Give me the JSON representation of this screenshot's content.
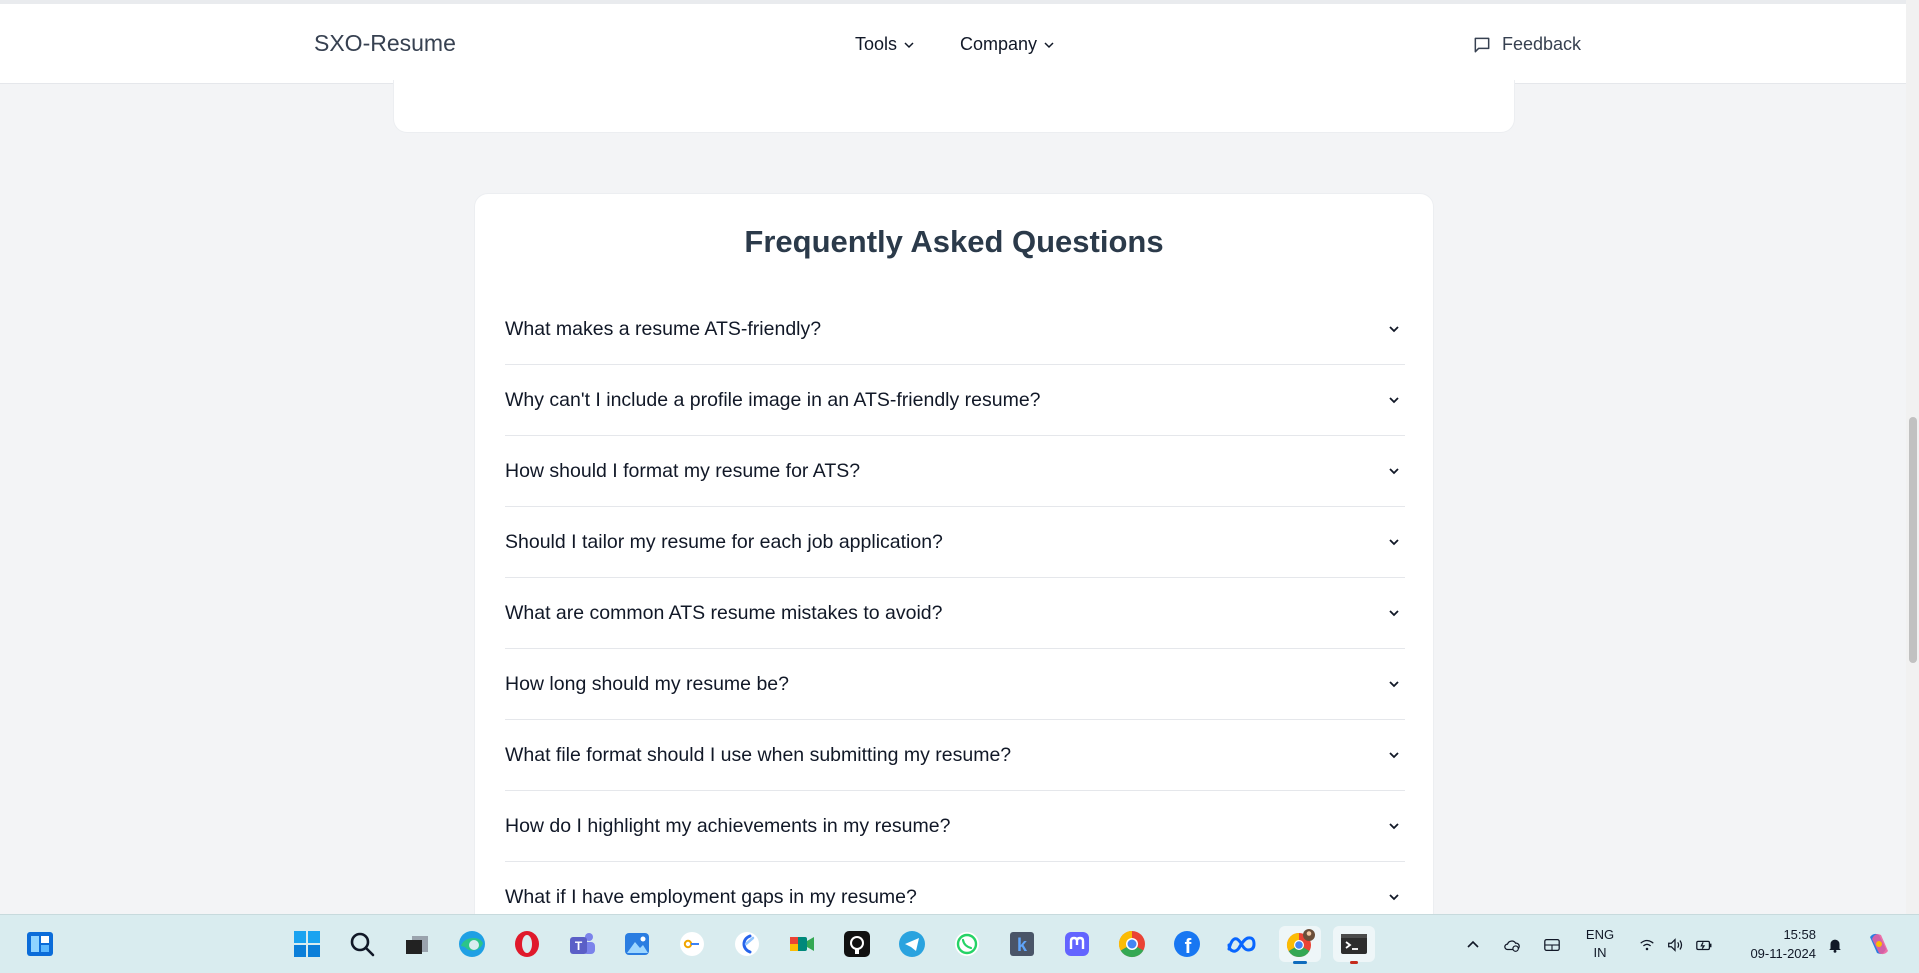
{
  "header": {
    "brand": "SXO-Resume",
    "nav": [
      {
        "label": "Tools"
      },
      {
        "label": "Company"
      }
    ],
    "feedback_label": "Feedback"
  },
  "faq": {
    "title": "Frequently Asked Questions",
    "items": [
      "What makes a resume ATS-friendly?",
      "Why can't I include a profile image in an ATS-friendly resume?",
      "How should I format my resume for ATS?",
      "Should I tailor my resume for each job application?",
      "What are common ATS resume mistakes to avoid?",
      "How long should my resume be?",
      "What file format should I use when submitting my resume?",
      "How do I highlight my achievements in my resume?",
      "What if I have employment gaps in my resume?"
    ]
  },
  "taskbar": {
    "apps": [
      {
        "name": "widgets-icon",
        "color": "#1a73e8"
      },
      {
        "name": "start-icon",
        "color": "#0078d4"
      },
      {
        "name": "search-icon",
        "color": "#111827"
      },
      {
        "name": "task-view-icon",
        "color": "#333333"
      },
      {
        "name": "edge-icon",
        "color": "#0c8a6b"
      },
      {
        "name": "opera-icon",
        "color": "#e0192b"
      },
      {
        "name": "teams-icon",
        "color": "#5b5fc7"
      },
      {
        "name": "photos-icon",
        "color": "#2a7de1"
      },
      {
        "name": "password-manager-icon",
        "color": "#f0a500"
      },
      {
        "name": "k-app-icon",
        "color": "#3b82f6"
      },
      {
        "name": "meet-icon",
        "color": "#00897b"
      },
      {
        "name": "github-icon",
        "color": "#111111"
      },
      {
        "name": "telegram-icon",
        "color": "#2aa3df"
      },
      {
        "name": "whatsapp-icon",
        "color": "#25d366"
      },
      {
        "name": "kde-icon",
        "color": "#4a5568"
      },
      {
        "name": "mastodon-icon",
        "color": "#6364ff"
      },
      {
        "name": "chrome-icon",
        "color": "#4285f4"
      },
      {
        "name": "facebook-icon",
        "color": "#1877f2"
      },
      {
        "name": "meta-icon",
        "color": "#0866ff"
      },
      {
        "name": "chrome-profile-icon",
        "color": "#34a853"
      },
      {
        "name": "terminal-icon",
        "color": "#2d2d2d"
      }
    ],
    "language": {
      "line1": "ENG",
      "line2": "IN"
    },
    "clock": {
      "time": "15:58",
      "date": "09-11-2024"
    }
  }
}
